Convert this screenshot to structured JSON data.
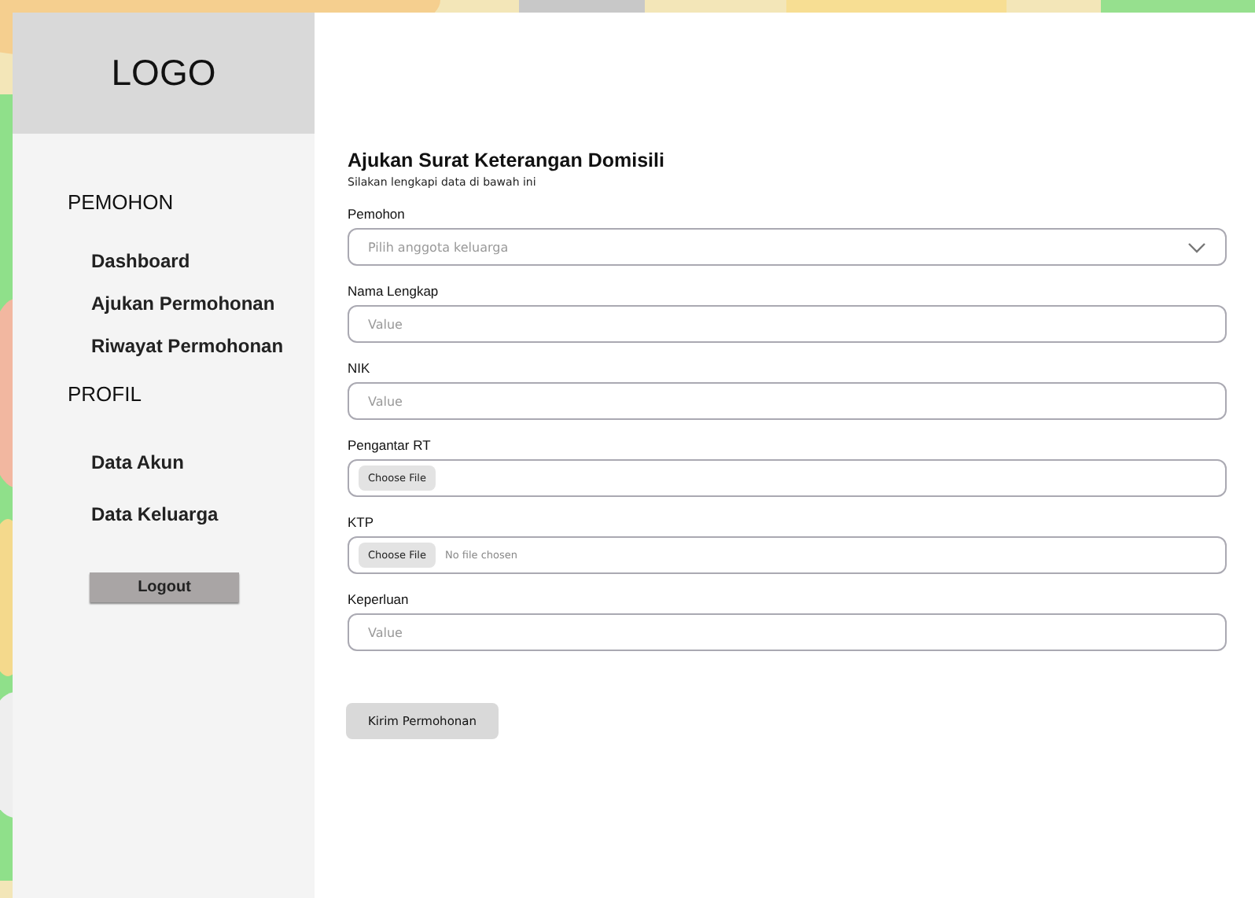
{
  "sidebar": {
    "logo": "LOGO",
    "sections": [
      {
        "heading": "PEMOHON",
        "items": [
          {
            "label": "Dashboard"
          },
          {
            "label": "Ajukan Permohonan"
          },
          {
            "label": "Riwayat Permohonan"
          }
        ]
      },
      {
        "heading": "PROFIL",
        "items": [
          {
            "label": "Data Akun"
          },
          {
            "label": "Data Keluarga"
          }
        ]
      }
    ],
    "logout": "Logout"
  },
  "form": {
    "title": "Ajukan Surat Keterangan Domisili",
    "subtitle": "Silakan lengkapi data di bawah ini",
    "fields": [
      {
        "kind": "select",
        "label": "Pemohon",
        "placeholder": "Pilih anggota keluarga"
      },
      {
        "kind": "text",
        "label": "Nama Lengkap",
        "placeholder": "Value"
      },
      {
        "kind": "text",
        "label": "NIK",
        "placeholder": "Value"
      },
      {
        "kind": "file",
        "label": "Pengantar RT",
        "button": "Choose File"
      },
      {
        "kind": "file",
        "label": "KTP",
        "button": "Choose File",
        "status": "No file chosen"
      },
      {
        "kind": "text",
        "label": "Keperluan",
        "placeholder": "Value"
      }
    ],
    "submit": "Kirim Permohonan"
  }
}
